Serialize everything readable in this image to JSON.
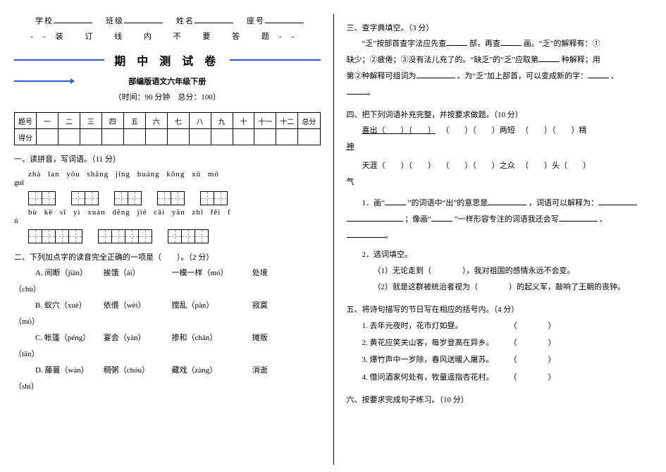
{
  "header": {
    "school_label": "学校",
    "class_label": "班级",
    "name_label": "姓名",
    "id_label": "座号",
    "seal_line": "装 订 线 内 不 要 答 题"
  },
  "title": {
    "main": "期 中 测 试 卷",
    "sub": "部编版语文六年级下册",
    "info": "（时间：90 分钟　总分：100）"
  },
  "score_table": {
    "row1": [
      "题号",
      "一",
      "二",
      "三",
      "四",
      "五",
      "六",
      "七",
      "八",
      "九",
      "十",
      "十一",
      "十二",
      "总分"
    ],
    "row2_label": "得分"
  },
  "q1": {
    "heading": "一、读拼音，写词语。（11 分）",
    "line1": "zhà  lan      yōu  shāng      jīng  huáng      kōng  xū      mó",
    "line1_tail": "guī",
    "line2": "bù  kě  sī  yì      xuán  dēng  jié  cǎi      yān  zhī  fěi   f",
    "line2_tail": "ú"
  },
  "q2": {
    "heading": "二、下列加点字的读音完全正确的一项是（　　）。（2 分）",
    "A": {
      "a": "A. 间断（jiān）",
      "b": "挨饿（ái）",
      "c": "一模一样（mó）",
      "d": "处境"
    },
    "A_tail": "（chù）",
    "B": {
      "a": "B. 蚁穴（xuè）",
      "b": "依偎（wèi）",
      "c": "搅乱（pàn）",
      "d": "寂寞"
    },
    "B_tail": "（mò）",
    "C": {
      "a": "C. 帐篷（péng）",
      "b": "宴会（yàn）",
      "c": "掺和（chān）",
      "d": "摊贩"
    },
    "C_tail": "（tān）",
    "D": {
      "a": "D. 藤蔓（wàn）",
      "b": "稠粥（chóu）",
      "c": "藏戏（zàng）",
      "d": "消逝"
    },
    "D_tail": "（shì）"
  },
  "q3": {
    "heading": "三、查字典填空。（3 分）",
    "body_a": "“乏”按部首查字法应先查",
    "body_b": "部，再查",
    "body_c": "画。“乏”的解释有：①",
    "line2_a": "缺少；②疲倦；③没有法儿充了的。“缺乏”的“乏”应取第",
    "line2_b": "种解释；用",
    "line3_a": "第②种解释可组词为",
    "line3_b": "。为“乏”加上部首，可以变成新的字：",
    "line3_c": "、"
  },
  "q4": {
    "heading": "四、把下列词语补充完整，并按要求做题。（10 分）",
    "row1_a": "喜出",
    "row1_b": "两短",
    "row1_c": "精",
    "row2_a": "神",
    "row3_a": "天涯",
    "row3_b": "之众",
    "row3_c": "头",
    "row4_a": "气",
    "item1_a": "1．画“",
    "item1_b": "”的词语中“出”的意思是",
    "item1_c": "，词语可以解释为：",
    "item1_d": "；像画“",
    "item1_e": "”一样形容专注的词语我还会写",
    "item1_f": "、",
    "item2": "2．选词填空。",
    "item2_1a": "（1）无论走到（",
    "item2_1b": "），我对祖国的感情永远不会变。",
    "item2_2a": "（2）就是这群被统治者视为（",
    "item2_2b": "）的起义军，敲响了王朝的丧钟。"
  },
  "q5": {
    "heading": "五、将诗句描写的节日写在相应的括号内。（4 分）",
    "l1": "1. 去年元夜时，花市灯如昼。",
    "l2": "2. 黄花应笑关山客，每岁登高在异乡。",
    "l3": "3. 爆竹声中一岁除，春风送暖入屠苏。",
    "l4": "4. 借问酒家何处有，牧童遥指杏花村。",
    "paren": "（　　　　）"
  },
  "q6": {
    "heading": "六、按要求完成句子练习。（10 分）"
  }
}
